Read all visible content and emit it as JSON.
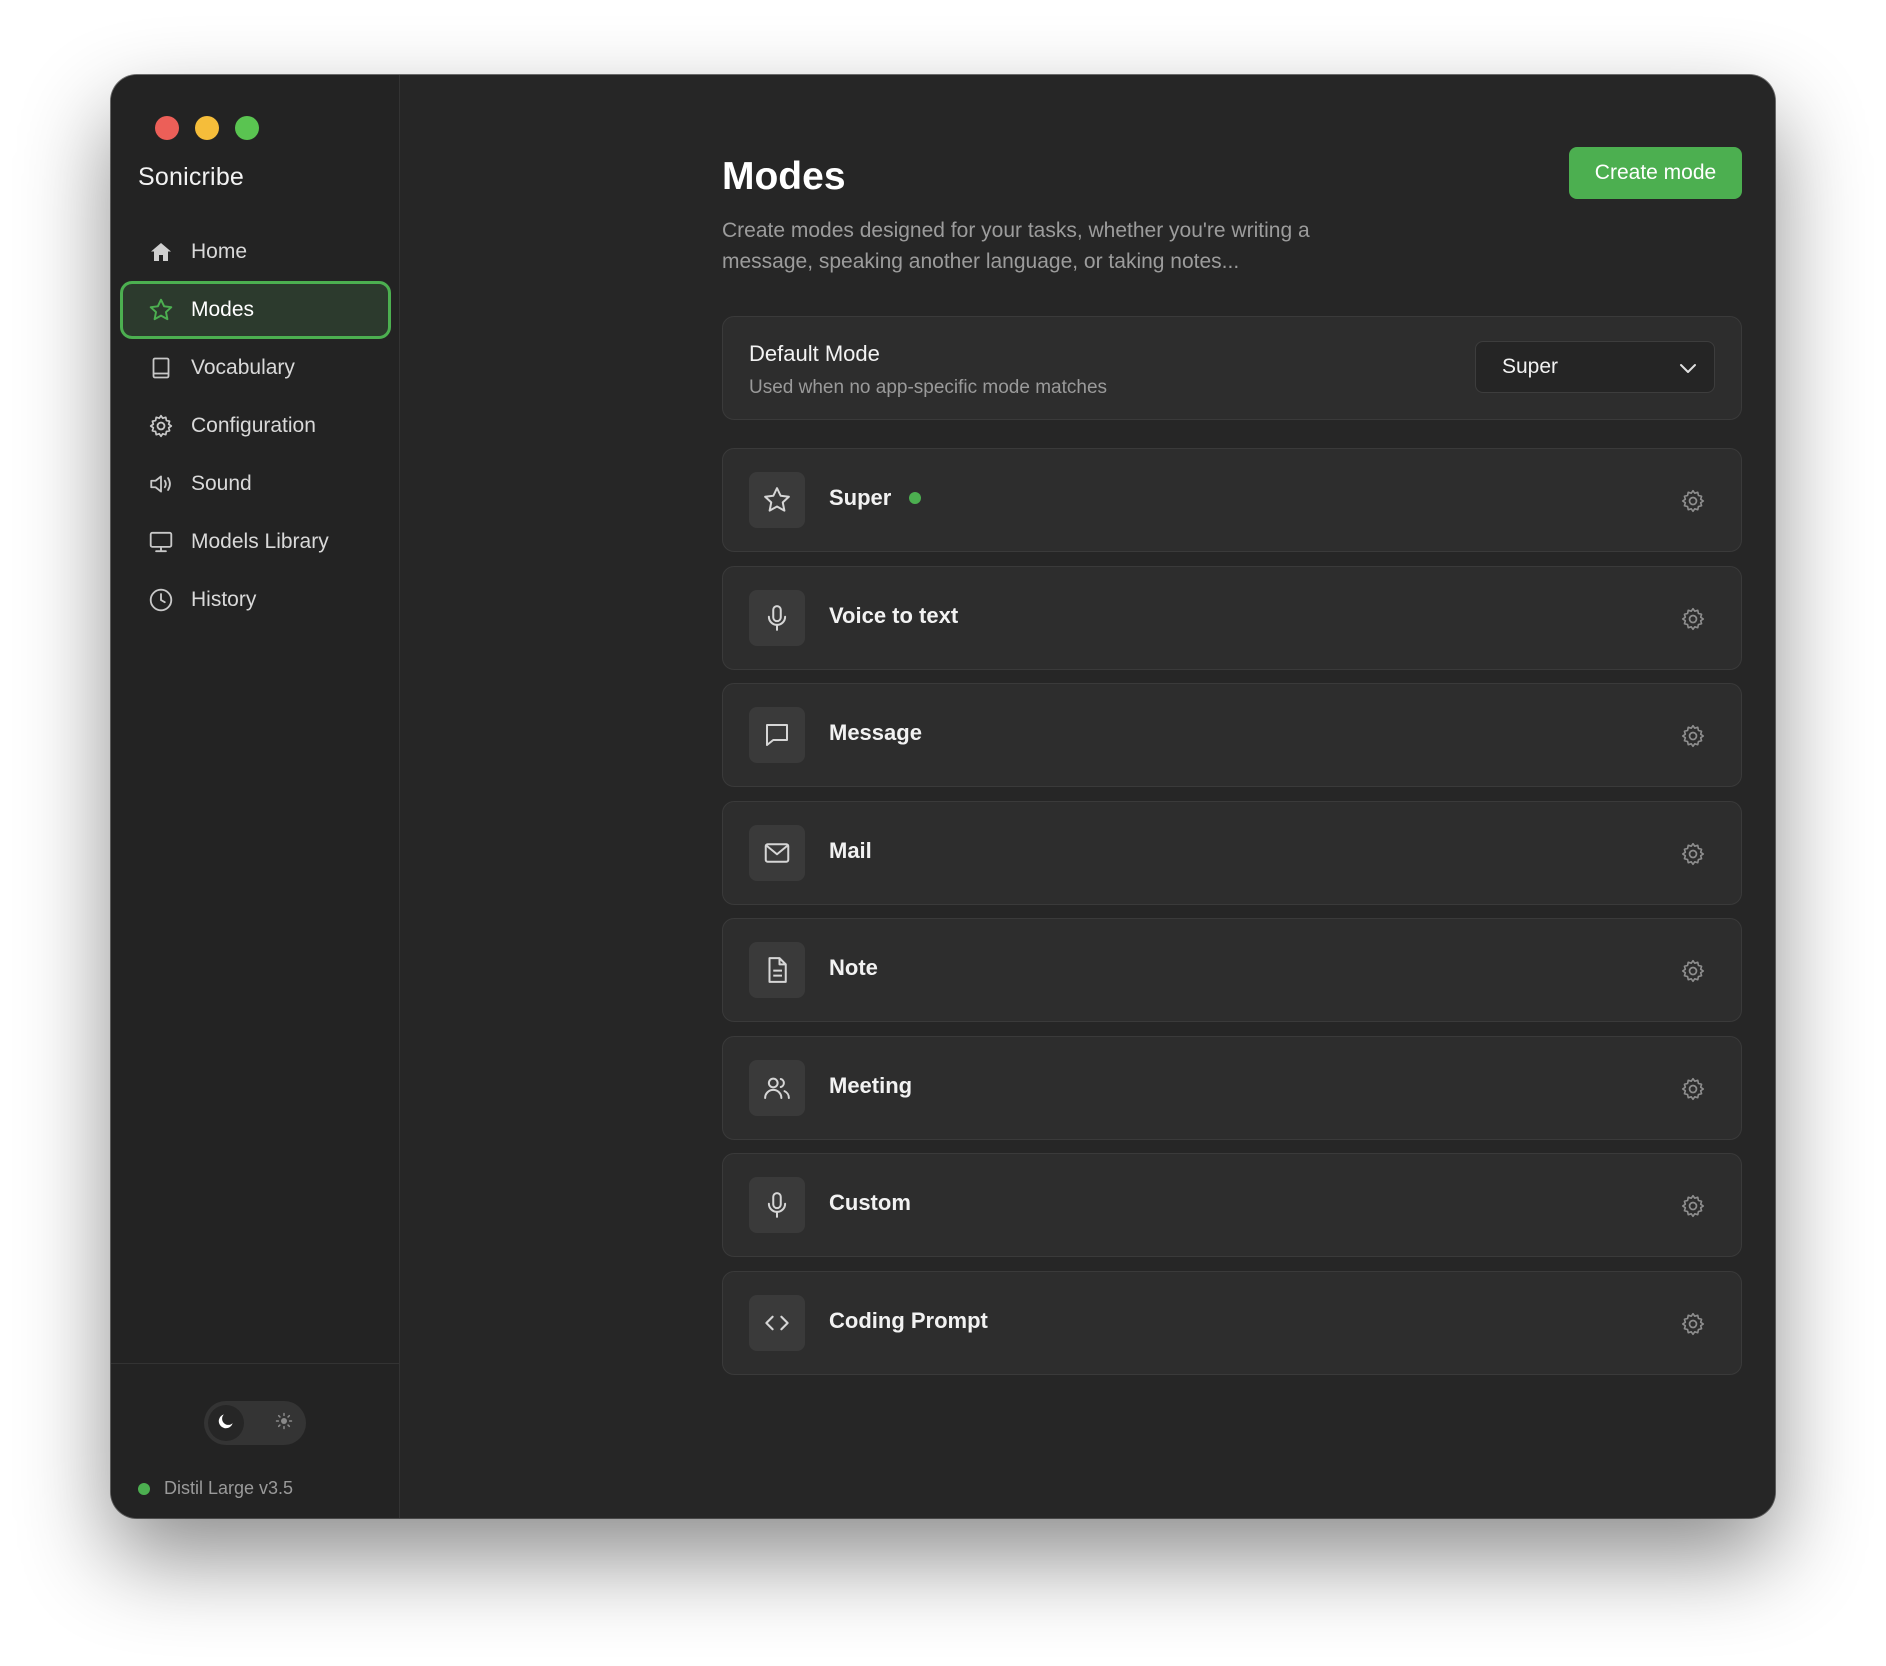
{
  "app": {
    "name": "Sonicribe"
  },
  "window_controls": {
    "close_color": "#ec5f58",
    "minimize_color": "#f5bd3a",
    "zoom_color": "#5ac451"
  },
  "sidebar": {
    "items": [
      {
        "label": "Home",
        "icon": "home-icon",
        "active": false
      },
      {
        "label": "Modes",
        "icon": "star-icon",
        "active": true
      },
      {
        "label": "Vocabulary",
        "icon": "book-icon",
        "active": false
      },
      {
        "label": "Configuration",
        "icon": "gear-icon",
        "active": false
      },
      {
        "label": "Sound",
        "icon": "speaker-icon",
        "active": false
      },
      {
        "label": "Models Library",
        "icon": "monitor-icon",
        "active": false
      },
      {
        "label": "History",
        "icon": "clock-icon",
        "active": false
      }
    ],
    "theme_toggle": {
      "selected": "dark"
    },
    "model_status": {
      "label": "Distil Large v3.5",
      "color": "#4caf50"
    }
  },
  "main": {
    "title": "Modes",
    "subtitle": "Create modes designed for your tasks, whether you're writing a message, speaking another language, or taking notes...",
    "create_button": "Create mode",
    "default_mode": {
      "label": "Default Mode",
      "description": "Used when no app-specific mode matches",
      "selected": "Super"
    },
    "modes": [
      {
        "name": "Super",
        "icon": "star-icon",
        "active": true
      },
      {
        "name": "Voice to text",
        "icon": "microphone-icon",
        "active": false
      },
      {
        "name": "Message",
        "icon": "message-icon",
        "active": false
      },
      {
        "name": "Mail",
        "icon": "mail-icon",
        "active": false
      },
      {
        "name": "Note",
        "icon": "document-icon",
        "active": false
      },
      {
        "name": "Meeting",
        "icon": "users-icon",
        "active": false
      },
      {
        "name": "Custom",
        "icon": "microphone-icon",
        "active": false
      },
      {
        "name": "Coding Prompt",
        "icon": "code-icon",
        "active": false
      }
    ]
  },
  "colors": {
    "accent": "#4caf50",
    "background": "#262626",
    "sidebar": "#232323",
    "card": "#2d2d2d"
  }
}
